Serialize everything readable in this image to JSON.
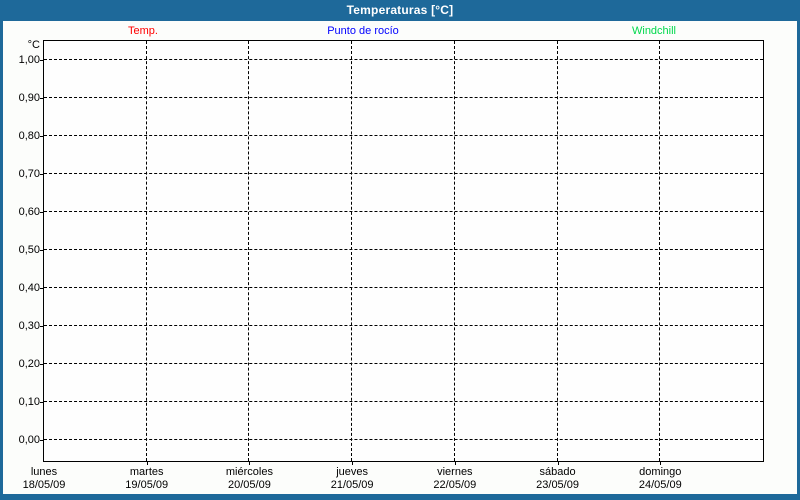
{
  "header": {
    "title": "Temperaturas [°C]"
  },
  "colors": {
    "frame_blue": "#1e699a",
    "temp_red": "#ff0000",
    "dew_point_blue": "#0000ff",
    "windchill_green": "#00d94c"
  },
  "chart_data": {
    "type": "line",
    "title": "Temperaturas [°C]",
    "unit": "°C",
    "ylim": [
      0.0,
      1.0
    ],
    "y_tick_labels": [
      "1,00",
      "0,90",
      "0,80",
      "0,70",
      "0,60",
      "0,50",
      "0,40",
      "0,30",
      "0,20",
      "0,10",
      "0,00"
    ],
    "y_tick_values": [
      1.0,
      0.9,
      0.8,
      0.7,
      0.6,
      0.5,
      0.4,
      0.3,
      0.2,
      0.1,
      0.0
    ],
    "categories": [
      {
        "day": "lunes",
        "date": "18/05/09"
      },
      {
        "day": "martes",
        "date": "19/05/09"
      },
      {
        "day": "miércoles",
        "date": "20/05/09"
      },
      {
        "day": "jueves",
        "date": "21/05/09"
      },
      {
        "day": "viernes",
        "date": "22/05/09"
      },
      {
        "day": "sábado",
        "date": "23/05/09"
      },
      {
        "day": "domingo",
        "date": "24/05/09"
      }
    ],
    "series": [
      {
        "name": "Temp.",
        "color": "#ff0000",
        "values": []
      },
      {
        "name": "Punto de rocío",
        "color": "#0000ff",
        "values": []
      },
      {
        "name": "Windchill",
        "color": "#00d94c",
        "values": []
      }
    ],
    "grid": {
      "horizontal": "dashed",
      "vertical": "dashed-at-day-boundaries",
      "background": "#fefefe"
    },
    "legend_position": "top",
    "plot_is_empty": true
  }
}
